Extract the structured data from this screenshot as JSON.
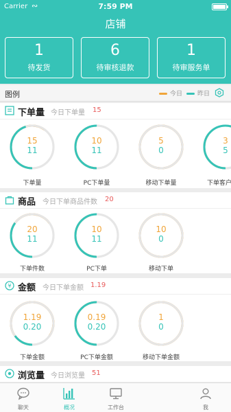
{
  "status_bar": {
    "carrier": "Carrier",
    "time": "7:59 PM"
  },
  "header": {
    "title": "店铺",
    "stats": [
      {
        "value": "1",
        "label": "待发货"
      },
      {
        "value": "6",
        "label": "待审核退款"
      },
      {
        "value": "1",
        "label": "待审服务单"
      }
    ]
  },
  "legend": {
    "title": "图例",
    "today": "今日",
    "yesterday": "昨日"
  },
  "colors": {
    "brand": "#36c3b7",
    "today": "#f0a53a",
    "yesterday": "#36c3b7",
    "highlight": "#e85a5a"
  },
  "sections": {
    "orders": {
      "title": "下单量",
      "subtitle": "今日下单量",
      "value": "15",
      "gauges": [
        {
          "today": "15",
          "yesterday": "11",
          "label": "下单量",
          "today_ratio": 0.6,
          "yesterday_ratio": 0.45
        },
        {
          "today": "10",
          "yesterday": "11",
          "label": "PC下单量",
          "today_ratio": 0.45,
          "yesterday_ratio": 0.5
        },
        {
          "today": "5",
          "yesterday": "0",
          "label": "移动下单量",
          "today_ratio": 1.0,
          "yesterday_ratio": 0
        },
        {
          "today": "3",
          "yesterday": "5",
          "label": "下单客户",
          "today_ratio": 0.35,
          "yesterday_ratio": 0.55
        }
      ]
    },
    "goods": {
      "title": "商品",
      "subtitle": "今日下单商品件数",
      "value": "20",
      "gauges": [
        {
          "today": "20",
          "yesterday": "11",
          "label": "下单件数",
          "today_ratio": 0.65,
          "yesterday_ratio": 0.35
        },
        {
          "today": "10",
          "yesterday": "11",
          "label": "PC下单",
          "today_ratio": 0.45,
          "yesterday_ratio": 0.5
        },
        {
          "today": "10",
          "yesterday": "0",
          "label": "移动下单",
          "today_ratio": 1.0,
          "yesterday_ratio": 0
        }
      ]
    },
    "amount": {
      "title": "金额",
      "subtitle": "今日下单金额",
      "value": "1.19",
      "gauges": [
        {
          "today": "1.19",
          "yesterday": "0.20",
          "label": "下单金额",
          "today_ratio": 0.85,
          "yesterday_ratio": 0.15
        },
        {
          "today": "0.19",
          "yesterday": "0.20",
          "label": "PC下单金额",
          "today_ratio": 0.5,
          "yesterday_ratio": 0.5
        },
        {
          "today": "1",
          "yesterday": "0",
          "label": "移动下单金额",
          "today_ratio": 1.0,
          "yesterday_ratio": 0
        }
      ]
    },
    "views": {
      "title": "浏览量",
      "subtitle": "今日浏览量",
      "value": "51"
    }
  },
  "tabbar": {
    "tabs": [
      {
        "label": "聊天",
        "icon": "chat-icon"
      },
      {
        "label": "概况",
        "icon": "bar-chart-icon"
      },
      {
        "label": "工作台",
        "icon": "monitor-icon"
      },
      {
        "label": "我",
        "icon": "person-icon"
      }
    ]
  }
}
